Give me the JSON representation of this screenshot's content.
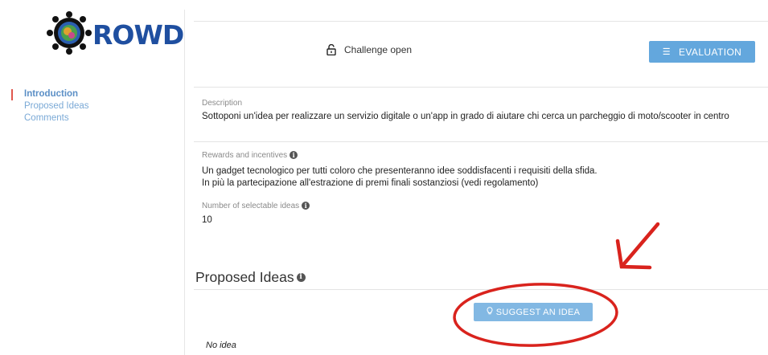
{
  "app": {
    "logo_text": "ROWD",
    "accent": "#1f4fa0",
    "annotation_color": "#d9231d"
  },
  "sidebar": {
    "items": [
      {
        "label": "Introduction",
        "active": true
      },
      {
        "label": "Proposed Ideas",
        "active": false
      },
      {
        "label": "Comments",
        "active": false
      }
    ]
  },
  "header": {
    "status_icon": "lock-open-icon",
    "status": "Challenge open",
    "evaluation_icon": "list-icon",
    "evaluation_label": "EVALUATION"
  },
  "details": {
    "description_label": "Description",
    "description": "Sottoponi un'idea per realizzare un servizio digitale o un'app in grado di aiutare chi cerca un parcheggio di moto/scooter in centro",
    "rewards_label": "Rewards and incentives",
    "rewards_line1": "Un gadget tecnologico per tutti coloro che presenteranno idee soddisfacenti i requisiti della sfida.",
    "rewards_line2": "In più la partecipazione all'estrazione di premi finali sostanziosi (vedi regolamento)",
    "selectable_label": "Number of selectable ideas",
    "selectable_value": "10"
  },
  "proposed": {
    "title": "Proposed Ideas",
    "suggest_icon": "lightbulb-icon",
    "suggest_label": "SUGGEST AN IDEA",
    "empty": "No idea"
  }
}
